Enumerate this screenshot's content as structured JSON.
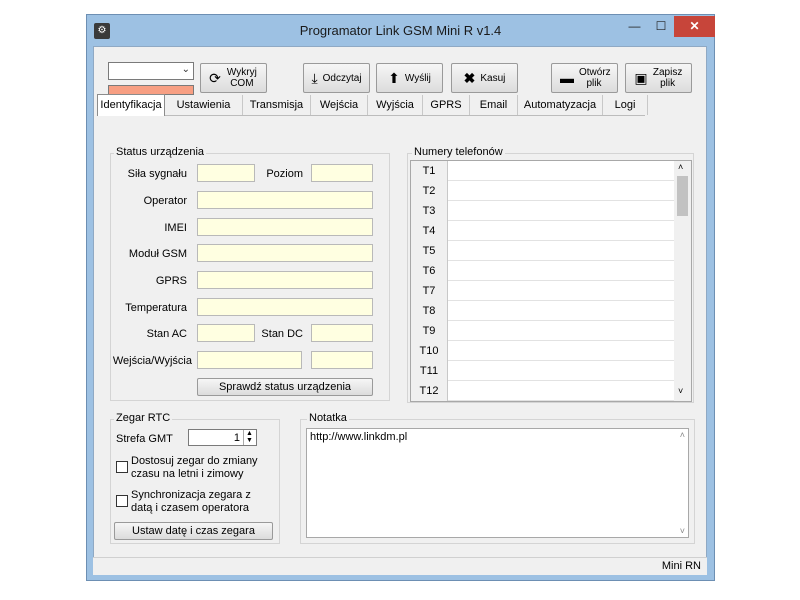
{
  "window": {
    "title": "Programator Link GSM Mini R v1.4",
    "minimize": "—",
    "maximize": "☐",
    "close": "✕",
    "icon": "app-icon"
  },
  "toolbar": {
    "com_select_value": "",
    "detect_com": "Wykryj COM",
    "read": "Odczytaj",
    "send": "Wyślij",
    "delete": "Kasuj",
    "open_file": "Otwórz plik",
    "save_file": "Zapisz plik"
  },
  "tabs": [
    "Identyfikacja",
    "Ustawienia",
    "Transmisja",
    "Wejścia",
    "Wyjścia",
    "GPRS",
    "Email",
    "Automatyzacja",
    "Logi"
  ],
  "status_group": {
    "title": "Status urządzenia",
    "signal_strength": "Siła sygnału",
    "level": "Poziom",
    "operator": "Operator",
    "imei": "IMEI",
    "gsm_module": "Moduł GSM",
    "gprs": "GPRS",
    "temperature": "Temperatura",
    "ac_state": "Stan AC",
    "dc_state": "Stan DC",
    "io": "Wejścia/Wyjścia",
    "check_button": "Sprawdź status urządzenia"
  },
  "phones": {
    "title": "Numery telefonów",
    "rows": [
      "T1",
      "T2",
      "T3",
      "T4",
      "T5",
      "T6",
      "T7",
      "T8",
      "T9",
      "T10",
      "T11",
      "T12"
    ]
  },
  "rtc": {
    "title": "Zegar RTC",
    "gmt_label": "Strefa GMT",
    "gmt_value": "1",
    "dst_label": "Dostosuj zegar do zmiany czasu na letni i zimowy",
    "sync_label": "Synchronizacja zegara z datą i czasem operatora",
    "set_button": "Ustaw datę i czas zegara"
  },
  "note": {
    "title": "Notatka",
    "text": "http://www.linkdm.pl"
  },
  "statusbar": {
    "text": "Mini RN"
  }
}
